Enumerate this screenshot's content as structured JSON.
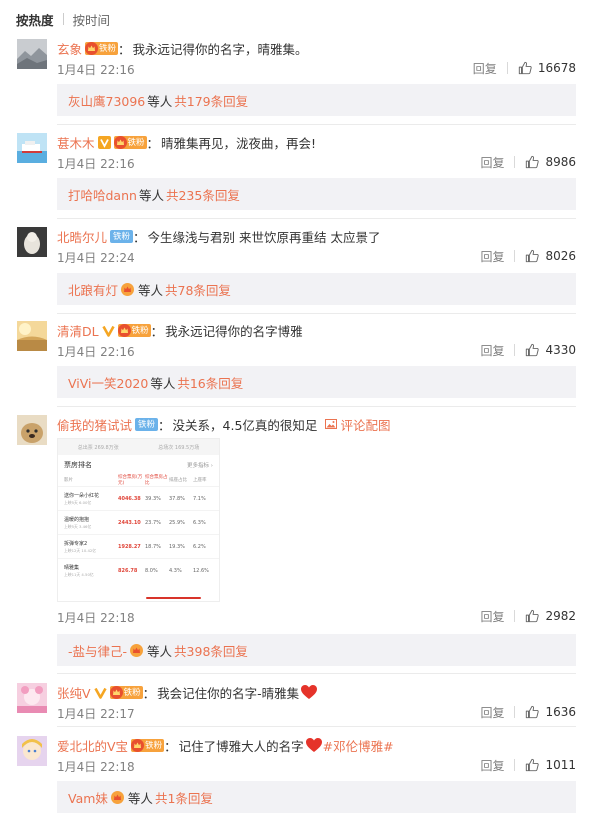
{
  "sort": {
    "hot": "按热度",
    "time": "按时间"
  },
  "labels": {
    "reply": "回复",
    "colon": "：",
    "etc": "等人"
  },
  "comments": [
    {
      "username": "玄象",
      "fan_label": "铁粉",
      "text": "我永远记得你的名字，晴雅集。",
      "date": "1月4日 22:16",
      "likes": "16678",
      "summary": {
        "who": "灰山鹰73096",
        "count": "共179条回复"
      }
    },
    {
      "username": "葚木木",
      "fan_label": "铁粉",
      "text": "晴雅集再见，泷夜曲，再会!",
      "date": "1月4日 22:16",
      "likes": "8986",
      "summary": {
        "who": "打哈哈dann",
        "count": "共235条回复"
      }
    },
    {
      "username": "北晧尔儿",
      "fan_label": "铁粉",
      "text": "今生缘浅与君别  来世饮原再重结 太应景了",
      "date": "1月4日 22:24",
      "likes": "8026",
      "summary": {
        "who": "北踉有灯",
        "count": "共78条回复"
      }
    },
    {
      "username": "清清DL",
      "fan_label": "铁粉",
      "text": "我永远记得你的名字博雅",
      "date": "1月4日 22:16",
      "likes": "4330",
      "summary": {
        "who": "ViVi一笑2020",
        "count": "共16条回复"
      }
    },
    {
      "username": "偷我的猪试试",
      "fan_label": "铁粉",
      "text": "没关系，4.5亿真的很知足",
      "pic_link": "评论配图",
      "date": "1月4日 22:18",
      "likes": "2982",
      "summary": {
        "who": "-盐与律己-",
        "count": "共398条回复"
      }
    },
    {
      "username": "张纯V",
      "fan_label": "铁粉",
      "text": "我会记住你的名字-晴雅集",
      "date": "1月4日 22:17",
      "likes": "1636"
    },
    {
      "username": "爱北北的V宝",
      "fan_label": "铁粉",
      "text": "记住了博雅大人的名字",
      "tag": "#邓伦博雅#",
      "date": "1月4日 22:18",
      "likes": "1011",
      "summary": {
        "who": "Vam妹",
        "count": "共1条回复"
      }
    }
  ],
  "screenshot": {
    "top_left": "总出票 269.8万张",
    "top_right": "总场次 169.5万场",
    "title": "票房排名",
    "more": "更多指标 ›",
    "headers": [
      "影片",
      "综合票房(万元)",
      "综合票房占比",
      "排座占比",
      "上座率"
    ],
    "rows": [
      {
        "name": "送你一朵小红花",
        "sub": "上映5天 6.00亿",
        "values": [
          "4046.38",
          "39.3%",
          "37.8%",
          "7.1%"
        ]
      },
      {
        "name": "温暖的抱抱",
        "sub": "上映5天 3.46亿",
        "values": [
          "2443.10",
          "23.7%",
          "25.9%",
          "6.3%"
        ]
      },
      {
        "name": "拆弹专家2",
        "sub": "上映12天 10.42亿",
        "values": [
          "1928.27",
          "18.7%",
          "19.3%",
          "6.2%"
        ]
      },
      {
        "name": "晴雅集",
        "sub": "上映11天 4.50亿",
        "values": [
          "826.78",
          "8.0%",
          "4.3%",
          "12.6%"
        ]
      }
    ]
  },
  "colors": {
    "accent": "#eb7350",
    "summary_bg": "#f2f2f5",
    "fan_badge": "#f7a23c",
    "fan_badge_blue": "#6bb2ea"
  }
}
